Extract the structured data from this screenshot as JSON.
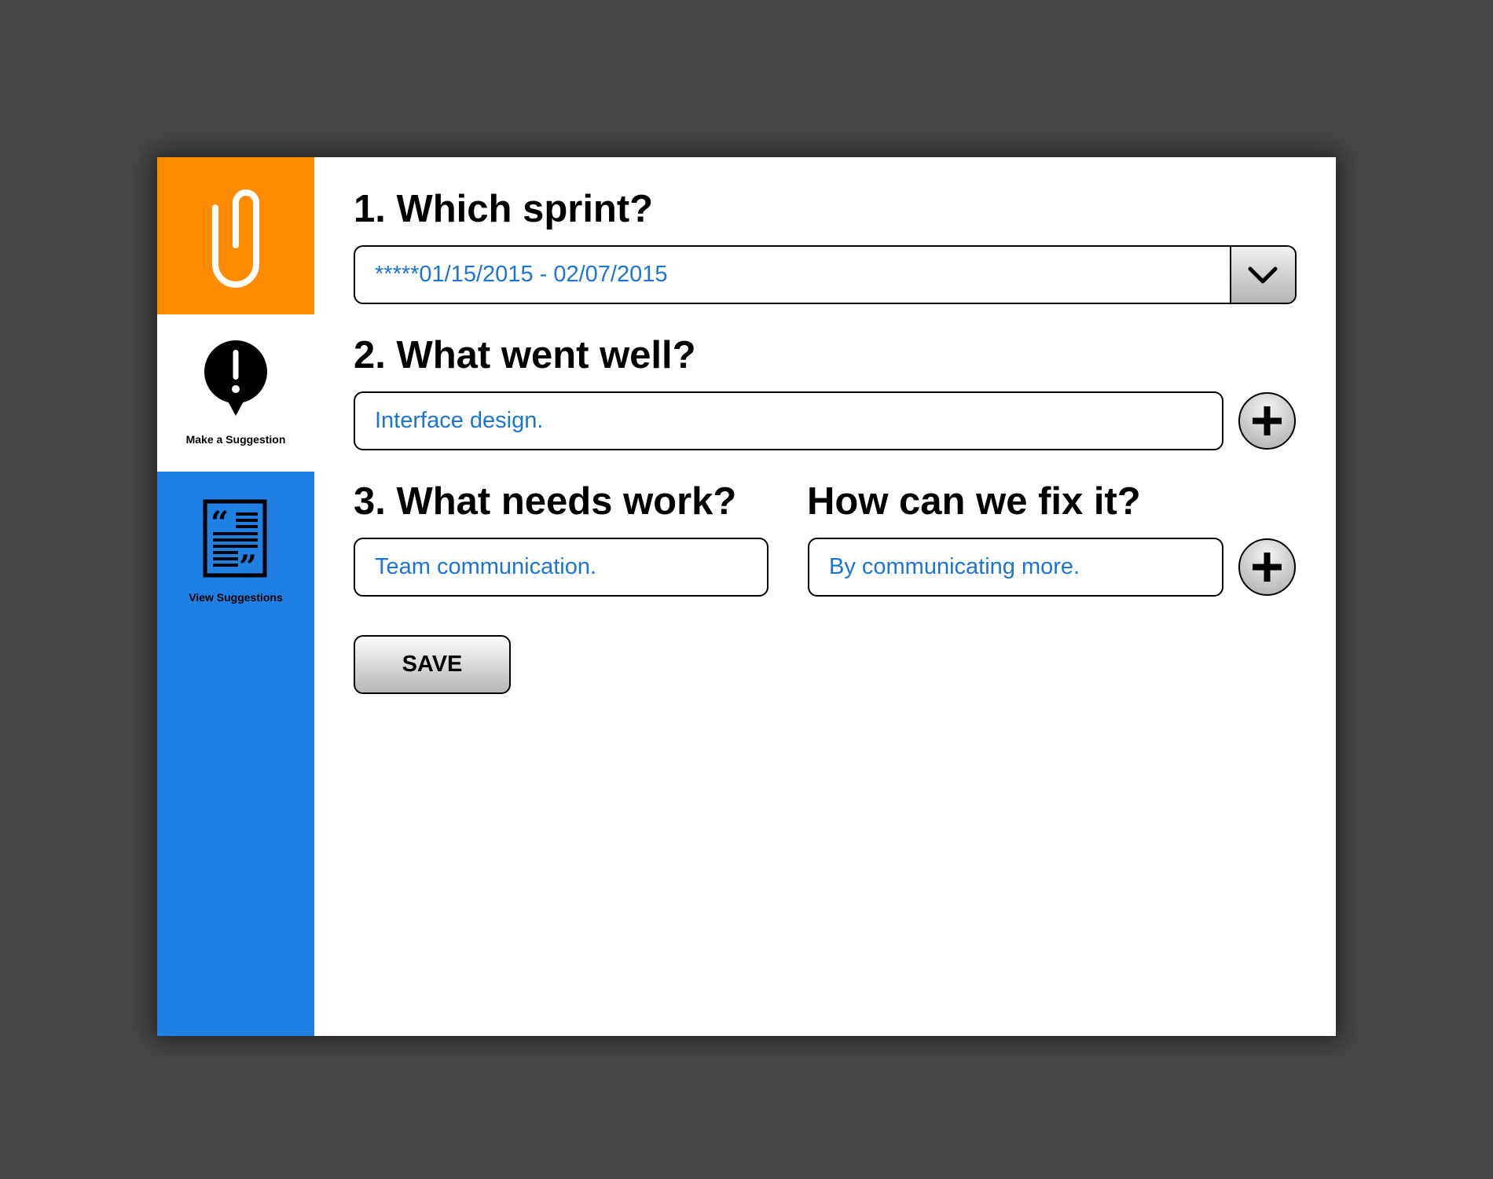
{
  "colors": {
    "background": "#474747",
    "sidebar_blue": "#207fe2",
    "logo_orange": "#ff8b00",
    "input_text_blue": "#1c74d6"
  },
  "sidebar": {
    "logo_icon": "paperclip-icon",
    "items": [
      {
        "label": "Make a Suggestion",
        "icon": "speech-bubble-exclamation-icon",
        "active": true
      },
      {
        "label": "View Suggestions",
        "icon": "quote-document-icon",
        "active": false
      }
    ]
  },
  "form": {
    "sprint": {
      "heading": "1. Which sprint?",
      "selected_value": "*****01/15/2015 - 02/07/2015",
      "dropdown_icon": "chevron-down-icon"
    },
    "went_well": {
      "heading": "2. What went well?",
      "value": "Interface design.",
      "add_icon": "plus-icon"
    },
    "needs_work": {
      "heading": "3. What needs work?",
      "value": "Team communication."
    },
    "fix_it": {
      "heading": "How can we fix it?",
      "value": "By communicating more.",
      "add_icon": "plus-icon"
    },
    "save_label": "SAVE"
  }
}
